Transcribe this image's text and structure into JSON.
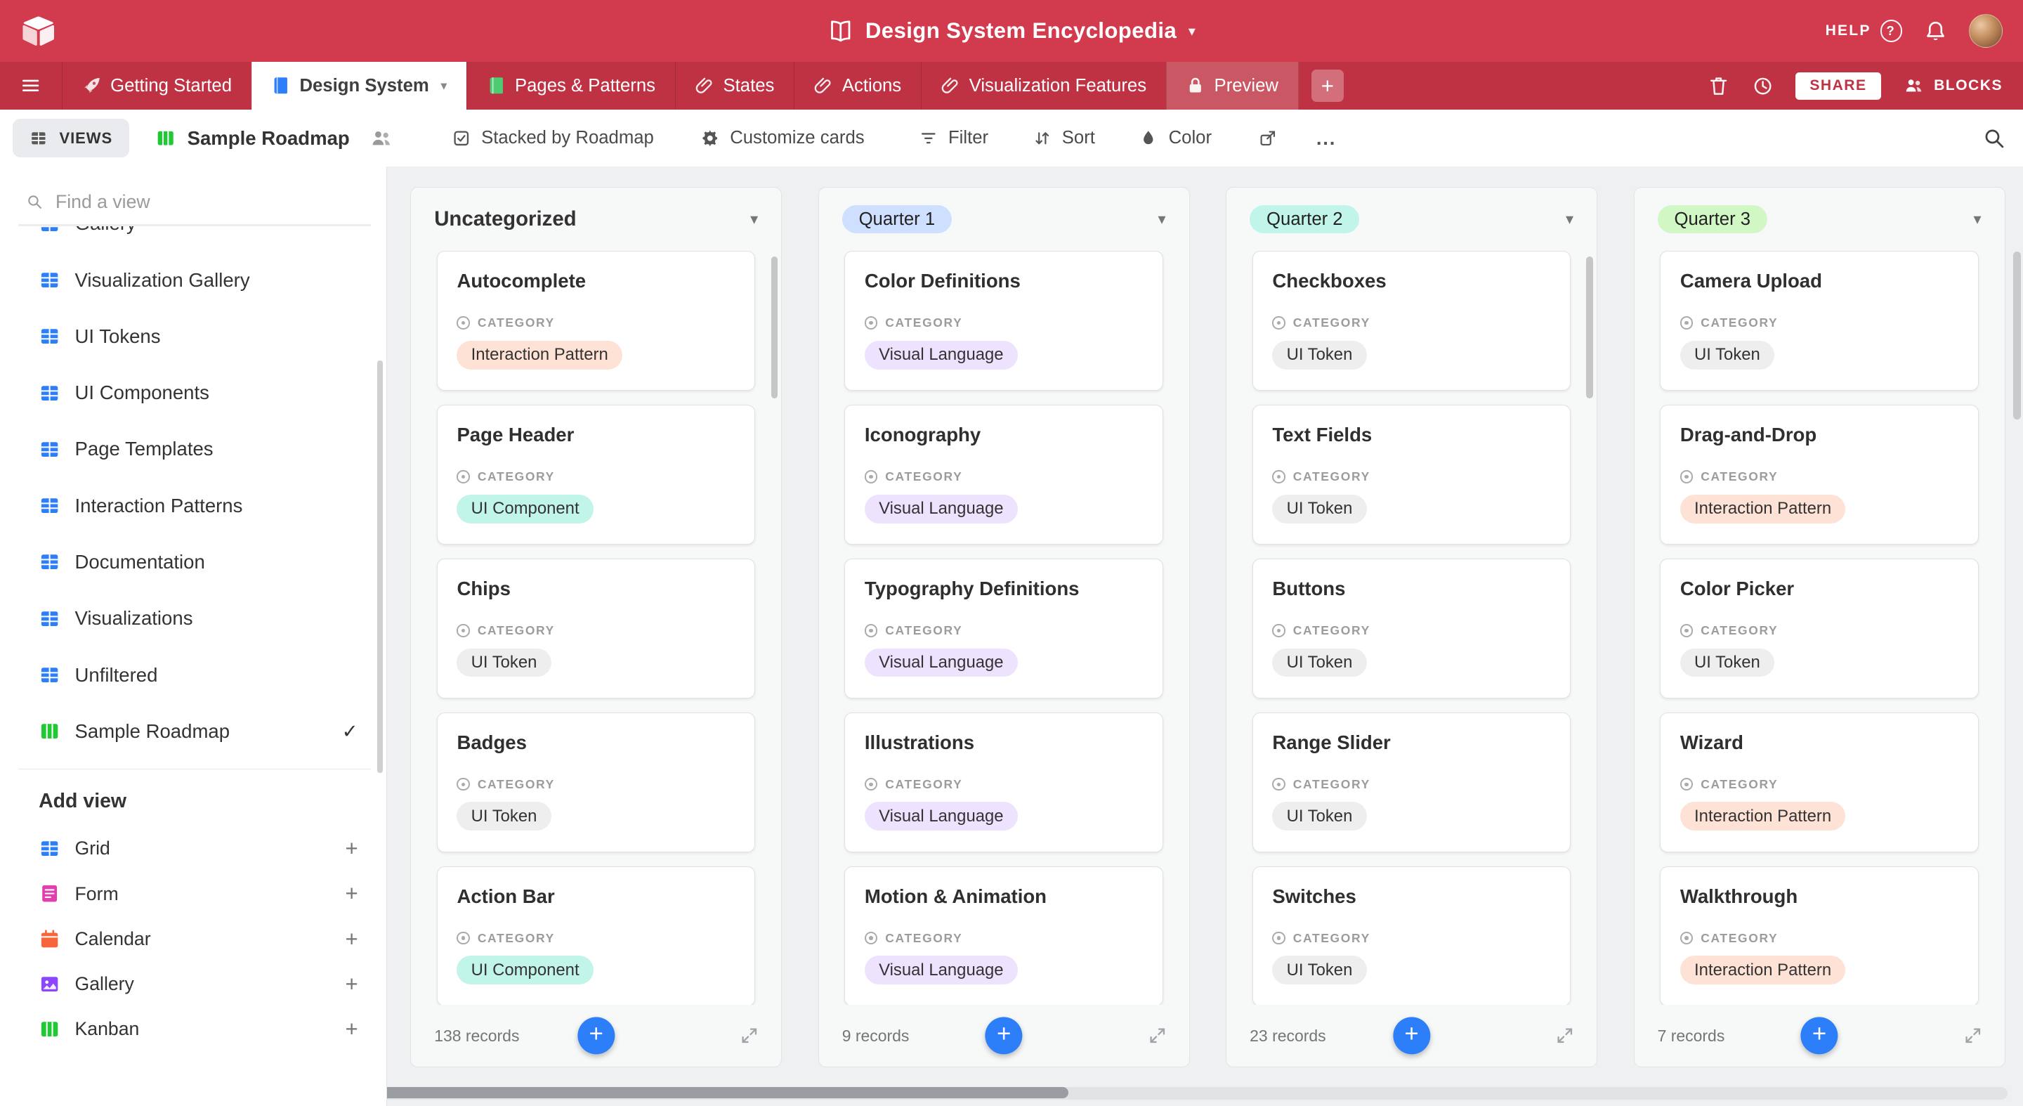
{
  "topbar": {
    "title": "Design System Encyclopedia",
    "help": "HELP"
  },
  "tabs": [
    {
      "label": "Getting Started",
      "icon": "rocket"
    },
    {
      "label": "Design System",
      "icon": "book",
      "icon_color": "#2d7ff9",
      "active": true
    },
    {
      "label": "Pages & Patterns",
      "icon": "book",
      "icon_color": "#4ecb71"
    },
    {
      "label": "States",
      "icon": "clip"
    },
    {
      "label": "Actions",
      "icon": "clip"
    },
    {
      "label": "Visualization Features",
      "icon": "clip"
    },
    {
      "label": "Preview",
      "icon": "lock",
      "muted": true
    }
  ],
  "tabbar_right": {
    "share": "SHARE",
    "blocks": "BLOCKS"
  },
  "toolbar": {
    "views": "VIEWS",
    "view_name": "Sample Roadmap",
    "stacked": "Stacked by Roadmap",
    "customize": "Customize cards",
    "filter": "Filter",
    "sort": "Sort",
    "color": "Color",
    "more": "..."
  },
  "sidebar": {
    "search_placeholder": "Find a view",
    "clipped_item": {
      "label": "Gallery",
      "icon": "grid",
      "color": "#2d7ff9"
    },
    "views": [
      {
        "label": "Visualization Gallery",
        "icon": "grid",
        "color": "#2d7ff9"
      },
      {
        "label": "UI Tokens",
        "icon": "grid",
        "color": "#2d7ff9"
      },
      {
        "label": "UI Components",
        "icon": "grid",
        "color": "#2d7ff9"
      },
      {
        "label": "Page Templates",
        "icon": "grid",
        "color": "#2d7ff9"
      },
      {
        "label": "Interaction Patterns",
        "icon": "grid",
        "color": "#2d7ff9"
      },
      {
        "label": "Documentation",
        "icon": "grid",
        "color": "#2d7ff9"
      },
      {
        "label": "Visualizations",
        "icon": "grid",
        "color": "#2d7ff9"
      },
      {
        "label": "Unfiltered",
        "icon": "grid",
        "color": "#2d7ff9"
      },
      {
        "label": "Sample Roadmap",
        "icon": "kanban",
        "color": "#20c933",
        "selected": true
      }
    ],
    "add_view": "Add view",
    "add_options": [
      {
        "label": "Grid",
        "icon": "grid",
        "color": "#2d7ff9"
      },
      {
        "label": "Form",
        "icon": "form",
        "color": "#e13fae"
      },
      {
        "label": "Calendar",
        "icon": "calendar",
        "color": "#f7653b"
      },
      {
        "label": "Gallery",
        "icon": "gallery",
        "color": "#8b46ff"
      },
      {
        "label": "Kanban",
        "icon": "kanban",
        "color": "#20c933"
      }
    ]
  },
  "board": {
    "category_field": "CATEGORY",
    "accent_blue": "#2d7ff9",
    "chip_colors": {
      "Interaction Pattern": "#fee2d5",
      "UI Component": "#c2f5e9",
      "UI Token": "#eeeeee",
      "Visual Language": "#ede3fe"
    },
    "columns": [
      {
        "title": "Uncategorized",
        "header_chip": null,
        "records": "138 records",
        "has_scrollbar": true,
        "cards": [
          {
            "title": "Autocomplete",
            "category": "Interaction Pattern"
          },
          {
            "title": "Page Header",
            "category": "UI Component"
          },
          {
            "title": "Chips",
            "category": "UI Token"
          },
          {
            "title": "Badges",
            "category": "UI Token"
          },
          {
            "title": "Action Bar",
            "category": "UI Component"
          }
        ]
      },
      {
        "title": "Quarter 1",
        "header_chip": "#cfdfff",
        "records": "9 records",
        "has_scrollbar": false,
        "cards": [
          {
            "title": "Color Definitions",
            "category": "Visual Language"
          },
          {
            "title": "Iconography",
            "category": "Visual Language"
          },
          {
            "title": "Typography Definitions",
            "category": "Visual Language"
          },
          {
            "title": "Illustrations",
            "category": "Visual Language"
          },
          {
            "title": "Motion & Animation",
            "category": "Visual Language"
          }
        ]
      },
      {
        "title": "Quarter 2",
        "header_chip": "#c2f5e9",
        "records": "23 records",
        "has_scrollbar": true,
        "cards": [
          {
            "title": "Checkboxes",
            "category": "UI Token"
          },
          {
            "title": "Text Fields",
            "category": "UI Token"
          },
          {
            "title": "Buttons",
            "category": "UI Token"
          },
          {
            "title": "Range Slider",
            "category": "UI Token"
          },
          {
            "title": "Switches",
            "category": "UI Token"
          }
        ]
      },
      {
        "title": "Quarter 3",
        "header_chip": "#d1f7c4",
        "records": "7 records",
        "has_scrollbar": false,
        "cards": [
          {
            "title": "Camera Upload",
            "category": "UI Token"
          },
          {
            "title": "Drag-and-Drop",
            "category": "Interaction Pattern"
          },
          {
            "title": "Color Picker",
            "category": "UI Token"
          },
          {
            "title": "Wizard",
            "category": "Interaction Pattern"
          },
          {
            "title": "Walkthrough",
            "category": "Interaction Pattern"
          }
        ]
      }
    ]
  }
}
